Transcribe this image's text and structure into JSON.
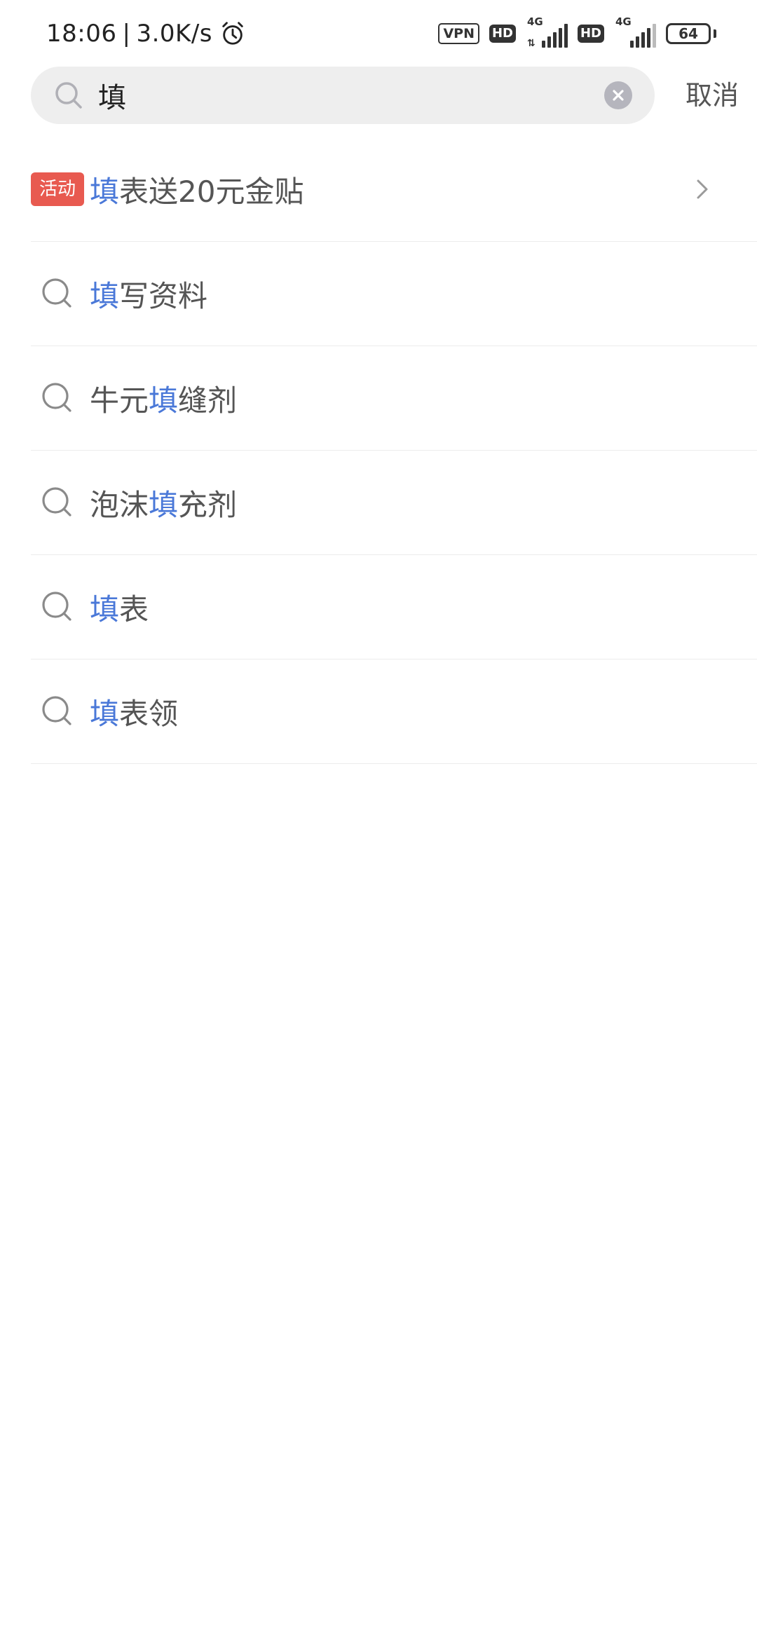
{
  "status_bar": {
    "time": "18:06",
    "separator": "|",
    "net_speed": "3.0K/s",
    "vpn": "VPN",
    "hd1": "HD",
    "hd2": "HD",
    "sim1_net": "4G",
    "sim1_arrows": "⇅",
    "sim2_net": "4G",
    "battery": "64",
    "icons": [
      "alarm-icon",
      "vpn-icon",
      "hd-icon",
      "signal-icon",
      "battery-icon"
    ]
  },
  "search": {
    "value": "填",
    "cancel_label": "取消",
    "icons": [
      "search-icon",
      "clear-icon"
    ]
  },
  "suggestions": [
    {
      "type": "promo",
      "tag": "活动",
      "pre": "",
      "hl": "填",
      "post": "表送20元金贴",
      "icon": "chevron-right-icon"
    },
    {
      "type": "query",
      "pre": "",
      "hl": "填",
      "post": "写资料",
      "icon": "search-icon"
    },
    {
      "type": "query",
      "pre": "牛元",
      "hl": "填",
      "post": "缝剂",
      "icon": "search-icon"
    },
    {
      "type": "query",
      "pre": "泡沫",
      "hl": "填",
      "post": "充剂",
      "icon": "search-icon"
    },
    {
      "type": "query",
      "pre": "",
      "hl": "填",
      "post": "表",
      "icon": "search-icon"
    },
    {
      "type": "query",
      "pre": "",
      "hl": "填",
      "post": "表领",
      "icon": "search-icon"
    }
  ],
  "colors": {
    "highlight": "#4a78d8",
    "promo_tag": "#e85a50",
    "search_bg": "#eeeeee",
    "text": "#555555"
  }
}
